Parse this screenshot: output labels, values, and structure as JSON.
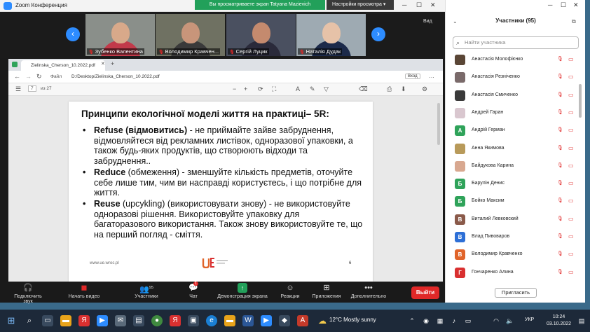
{
  "window": {
    "title": "Zoom Конференция",
    "share_banner": "Вы просматриваете экран Tatyana Mazievich",
    "view_options": "Настройки просмотра ▾",
    "strip_view": "Вид"
  },
  "video_strip": {
    "participants": [
      {
        "name": "Зубенко Валентина",
        "skin": "#d8a98a",
        "bg": "#8a8f8a",
        "shirt": "#c23a4a"
      },
      {
        "name": "Володимир Кравчен...",
        "skin": "#c8957a",
        "bg": "#6f7162",
        "shirt": "#3a3a3a"
      },
      {
        "name": "Сергій Луцик",
        "skin": "#c48a6e",
        "bg": "#4a5060",
        "shirt": "#2a2a3a"
      },
      {
        "name": "Наталія Дудак",
        "skin": "#e6c2a8",
        "bg": "#9eaab2",
        "shirt": "#1c2a4a"
      }
    ]
  },
  "browser": {
    "tab_title": "Zielinska_Cherson_10.2022.pdf",
    "address_prefix": "Файл",
    "address": "D:/Desktop/Zielinska_Cherson_10.2022.pdf",
    "page_current": "7",
    "page_total": "из 27"
  },
  "slide": {
    "title": "Принципи екологічної моделі життя на практиці– 5R:",
    "bullets": [
      {
        "term": "Refuse",
        "rest_bold": " (відмовитись)",
        "text": " - не приймайте зайве забруднення, відмовляйтеся від рекламних листівок, одноразової упаковки, а також будь-яких продуктів, що створюють відходи та забруднення.."
      },
      {
        "term": "Reduce",
        "rest_bold": "",
        "text": " (обмеження) - зменшуйте кількість предметів, оточуйте себе лише тим, чим ви насправді користуєтесь, і що потрібне для життя."
      },
      {
        "term": "Reuse",
        "rest_bold": "",
        "text": " (upcykling) (використовувати знову) - не використовуйте одноразові рішення. Використовуйте упаковку для багаторазового використання. Також знову використовуйте те, що на перший погляд - сміття."
      }
    ],
    "footer_url": "www.ue.wroc.pl",
    "page_number": "6"
  },
  "controls": {
    "audio": "Подключить звук",
    "video": "Начать видео",
    "participants": "Участники",
    "participants_count": "95",
    "chat": "Чат",
    "chat_badge": "1",
    "share": "Демонстрация экрана",
    "reactions": "Реакции",
    "apps": "Приложения",
    "more": "Дополнительно",
    "leave": "Выйти"
  },
  "panel": {
    "header": "Участники (95)",
    "search_placeholder": "Найти участника",
    "invite": "Пригласить",
    "list": [
      {
        "name": "Анастасія Молофієнко",
        "initial": "",
        "color": "#5a4636"
      },
      {
        "name": "Анастасія Резніченко",
        "initial": "",
        "color": "#7a6a6a"
      },
      {
        "name": "Анастасія Смиченко",
        "initial": "",
        "color": "#3a3a3a"
      },
      {
        "name": "Андрей Гаран",
        "initial": "",
        "color": "#d9c7cf"
      },
      {
        "name": "Андрій Герман",
        "initial": "А",
        "color": "#2fa35a"
      },
      {
        "name": "Анна Якимова",
        "initial": "",
        "color": "#b89a5a"
      },
      {
        "name": "Байдукова Карина",
        "initial": "",
        "color": "#d8a890"
      },
      {
        "name": "Барулін Денис",
        "initial": "Б",
        "color": "#2fa35a"
      },
      {
        "name": "Бойко Максим",
        "initial": "Б",
        "color": "#2fa35a"
      },
      {
        "name": "Виталий Левковский",
        "initial": "В",
        "color": "#8a5a4a"
      },
      {
        "name": "Влад Пивоваров",
        "initial": "В",
        "color": "#2d6fd6"
      },
      {
        "name": "Володимир Кравченко",
        "initial": "В",
        "color": "#e0642a"
      },
      {
        "name": "Гончаренко Алина",
        "initial": "Г",
        "color": "#d93030"
      }
    ]
  },
  "taskbar": {
    "weather": "12°C  Mostly sunny",
    "lang": "УКР",
    "time": "10:24",
    "date": "03.10.2022"
  }
}
